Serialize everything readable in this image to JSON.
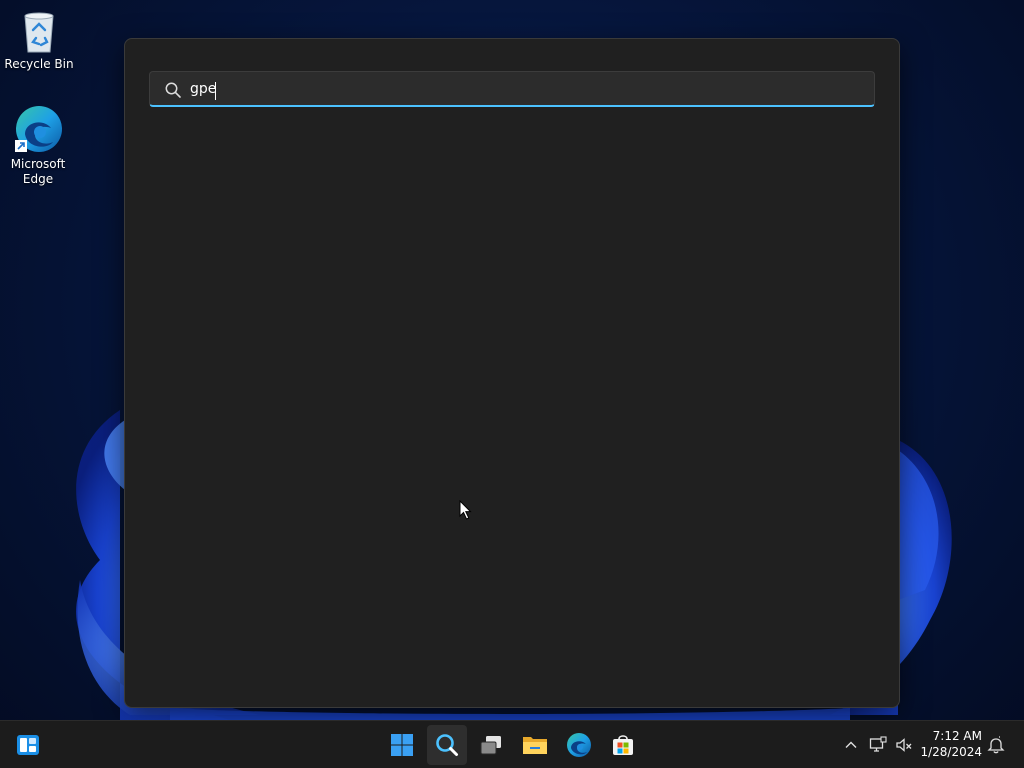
{
  "desktop": {
    "icons": [
      {
        "label": "Recycle Bin",
        "icon": "recycle-bin-icon"
      },
      {
        "label": "Microsoft Edge",
        "icon": "edge-icon"
      }
    ]
  },
  "search": {
    "query": "gpe",
    "icon": "search-icon",
    "accent_color": "#4cc2ff"
  },
  "taskbar": {
    "widgets_icon": "widgets-icon",
    "apps": [
      {
        "name": "Start",
        "icon": "windows-logo-icon",
        "active": false
      },
      {
        "name": "Search",
        "icon": "search-icon",
        "active": true
      },
      {
        "name": "Task View",
        "icon": "task-view-icon",
        "active": false
      },
      {
        "name": "File Explorer",
        "icon": "folder-icon",
        "active": false
      },
      {
        "name": "Microsoft Edge",
        "icon": "edge-icon",
        "active": false
      },
      {
        "name": "Microsoft Store",
        "icon": "store-icon",
        "active": false
      }
    ],
    "tray": {
      "icons": [
        "chevron-up-icon",
        "network-icon",
        "volume-muted-icon",
        "notification-icon"
      ],
      "time": "7:12 AM",
      "date": "1/28/2024"
    }
  }
}
